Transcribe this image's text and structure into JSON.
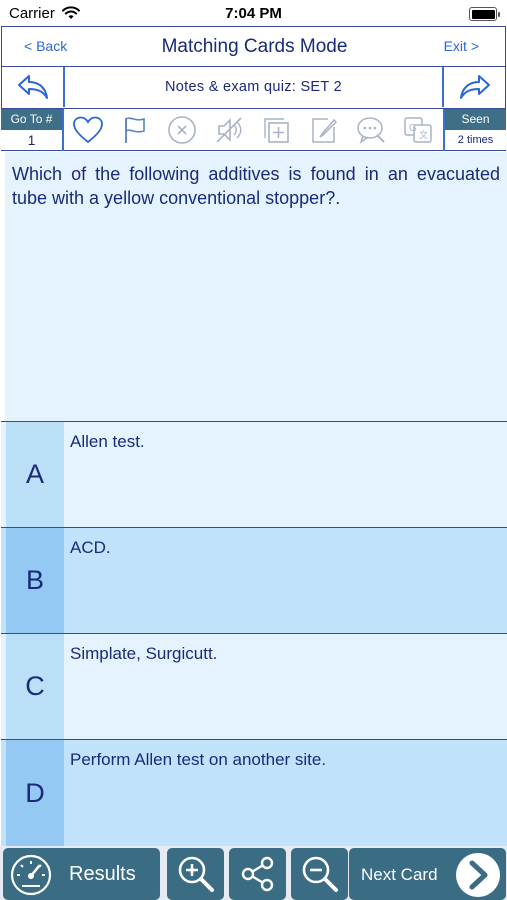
{
  "status_bar": {
    "carrier": "Carrier",
    "time": "7:04 PM"
  },
  "nav": {
    "back_label": "< Back",
    "title": "Matching Cards Mode",
    "exit_label": "Exit >"
  },
  "quiz": {
    "title": "Notes & exam quiz: SET 2"
  },
  "toolbar": {
    "goto_label": "Go To #",
    "goto_value": "1",
    "seen_label": "Seen",
    "seen_value": "2 times",
    "icons": [
      "heart-icon",
      "flag-icon",
      "close-circle-icon",
      "mute-icon",
      "add-card-icon",
      "edit-icon",
      "comment-icon",
      "translate-icon"
    ]
  },
  "question": {
    "text": "Which of the following additives is found in an evacuated tube with a yellow conventional stopper?."
  },
  "answers": [
    {
      "letter": "A",
      "text": "Allen test."
    },
    {
      "letter": "B",
      "text": "ACD."
    },
    {
      "letter": "C",
      "text": "Simplate, Surgicutt."
    },
    {
      "letter": "D",
      "text": "Perform Allen test on another site."
    }
  ],
  "bottom_bar": {
    "results_label": "Results",
    "next_label": "Next Card"
  },
  "colors": {
    "primary_text": "#1a2a7a",
    "link": "#2a66d8",
    "teal_button": "#3a6c84",
    "question_bg": "#e4f3fd",
    "answer_light": "#e4f3fd",
    "answer_dark": "#c0e2fb"
  }
}
